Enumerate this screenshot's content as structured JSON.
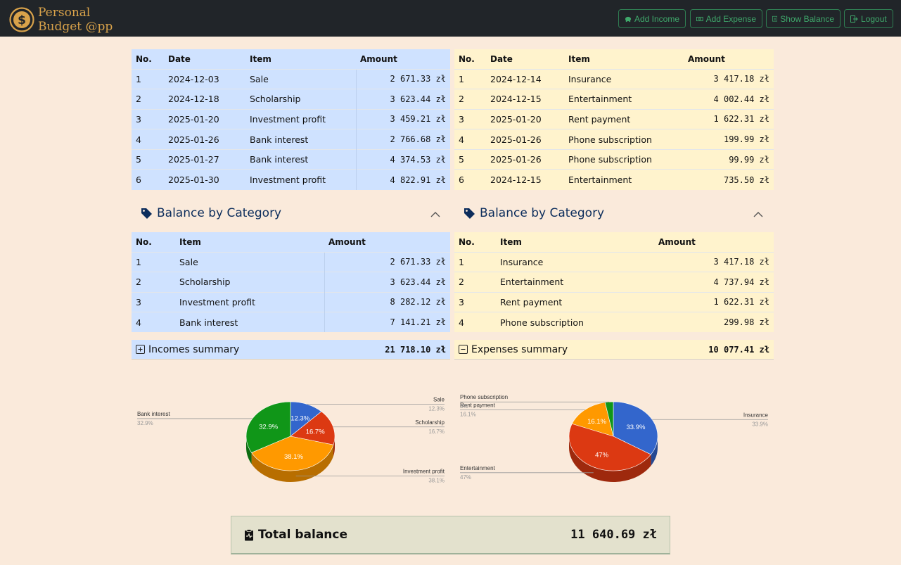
{
  "header": {
    "brand_line1": "Personal",
    "brand_line2": "Budget @pp",
    "buttons": {
      "add_income": "Add Income",
      "add_expense": "Add Expense",
      "show_balance": "Show Balance",
      "logout": "Logout"
    }
  },
  "colors": {
    "navbar": "#212529",
    "brand": "#d8a24a",
    "nav_button": "#3fa86b",
    "income_bg": "#cfe2ff",
    "expense_bg": "#fff3cd",
    "page_bg": "#faeadb",
    "pie_blue": "#3366cc",
    "pie_red": "#dc3912",
    "pie_orange": "#ff9900",
    "pie_green": "#109618"
  },
  "incomes": {
    "columns": [
      "No.",
      "Date",
      "Item",
      "Amount"
    ],
    "rows": [
      [
        "1",
        "2024-12-03",
        "Sale",
        "2 671.33 zł"
      ],
      [
        "2",
        "2024-12-18",
        "Scholarship",
        "3 623.44 zł"
      ],
      [
        "3",
        "2025-01-20",
        "Investment profit",
        "3 459.21 zł"
      ],
      [
        "4",
        "2025-01-26",
        "Bank interest",
        "2 766.68 zł"
      ],
      [
        "5",
        "2025-01-27",
        "Bank interest",
        "4 374.53 zł"
      ],
      [
        "6",
        "2025-01-30",
        "Investment profit",
        "4 822.91 zł"
      ]
    ],
    "by_category_title": "Balance by Category",
    "category_columns": [
      "No.",
      "Item",
      "Amount"
    ],
    "categories": [
      [
        "1",
        "Sale",
        "2 671.33 zł"
      ],
      [
        "2",
        "Scholarship",
        "3 623.44 zł"
      ],
      [
        "3",
        "Investment profit",
        "8 282.12 zł"
      ],
      [
        "4",
        "Bank interest",
        "7 141.21 zł"
      ]
    ],
    "summary_label": "Incomes summary",
    "summary_value": "21 718.10 zł"
  },
  "expenses": {
    "columns": [
      "No.",
      "Date",
      "Item",
      "Amount"
    ],
    "rows": [
      [
        "1",
        "2024-12-14",
        "Insurance",
        "3 417.18 zł"
      ],
      [
        "2",
        "2024-12-15",
        "Entertainment",
        "4 002.44 zł"
      ],
      [
        "3",
        "2025-01-20",
        "Rent payment",
        "1 622.31 zł"
      ],
      [
        "4",
        "2025-01-26",
        "Phone subscription",
        "199.99 zł"
      ],
      [
        "5",
        "2025-01-26",
        "Phone subscription",
        "99.99 zł"
      ],
      [
        "6",
        "2024-12-15",
        "Entertainment",
        "735.50 zł"
      ]
    ],
    "by_category_title": "Balance by Category",
    "category_columns": [
      "No.",
      "Item",
      "Amount"
    ],
    "categories": [
      [
        "1",
        "Insurance",
        "3 417.18 zł"
      ],
      [
        "2",
        "Entertainment",
        "4 737.94 zł"
      ],
      [
        "3",
        "Rent payment",
        "1 622.31 zł"
      ],
      [
        "4",
        "Phone subscription",
        "299.98 zł"
      ]
    ],
    "summary_label": "Expenses summary",
    "summary_value": "10 077.41 zł"
  },
  "chart_data": [
    {
      "type": "pie",
      "title": "",
      "slices": [
        {
          "label": "Sale",
          "value": 12.3,
          "pct_label": "12.3%",
          "color": "#3366cc"
        },
        {
          "label": "Scholarship",
          "value": 16.7,
          "pct_label": "16.7%",
          "color": "#dc3912"
        },
        {
          "label": "Investment profit",
          "value": 38.1,
          "pct_label": "38.1%",
          "color": "#ff9900"
        },
        {
          "label": "Bank interest",
          "value": 32.9,
          "pct_label": "32.9%",
          "color": "#109618"
        }
      ]
    },
    {
      "type": "pie",
      "title": "",
      "slices": [
        {
          "label": "Insurance",
          "value": 33.9,
          "pct_label": "33.9%",
          "color": "#3366cc"
        },
        {
          "label": "Entertainment",
          "value": 47,
          "pct_label": "47%",
          "color": "#dc3912"
        },
        {
          "label": "Rent payment",
          "value": 16.1,
          "pct_label": "16.1%",
          "color": "#ff9900"
        },
        {
          "label": "Phone subscription",
          "value": 3,
          "pct_label": "3%",
          "color": "#109618"
        }
      ]
    }
  ],
  "total": {
    "label": "Total balance",
    "value": "11 640.69 zł"
  }
}
